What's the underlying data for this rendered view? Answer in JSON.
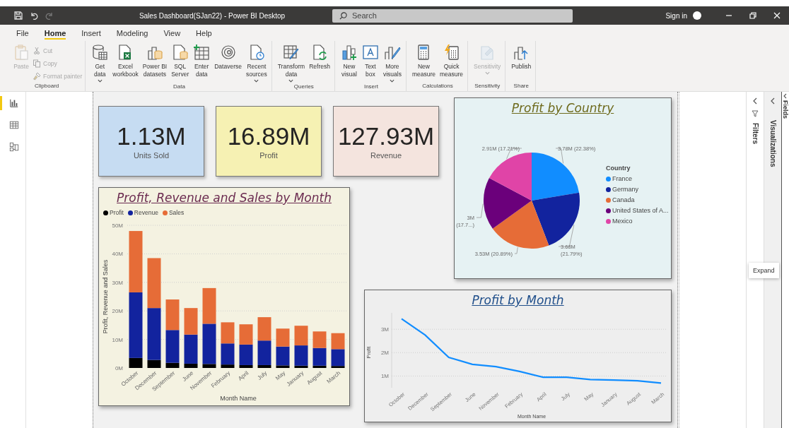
{
  "window": {
    "title": "Sales Dashboard(SJan22) - Power BI Desktop",
    "search": {
      "placeholder": "Search"
    },
    "sign_in": "Sign in"
  },
  "menu_tabs": [
    {
      "label": "File",
      "selected": false
    },
    {
      "label": "Home",
      "selected": true
    },
    {
      "label": "Insert",
      "selected": false
    },
    {
      "label": "Modeling",
      "selected": false
    },
    {
      "label": "View",
      "selected": false
    },
    {
      "label": "Help",
      "selected": false
    }
  ],
  "ribbon": {
    "groups": [
      {
        "label": "Clipboard",
        "buttons": [
          {
            "label": "Paste",
            "kind": "large",
            "disabled": true,
            "dropdown": false
          },
          {
            "label": "Cut",
            "kind": "small",
            "disabled": true,
            "dropdown": false
          },
          {
            "label": "Copy",
            "kind": "small",
            "disabled": true,
            "dropdown": false
          },
          {
            "label": "Format painter",
            "kind": "small",
            "disabled": true,
            "dropdown": false
          }
        ]
      },
      {
        "label": "Data",
        "buttons": [
          {
            "label": "Get\ndata",
            "kind": "large",
            "disabled": false,
            "dropdown": true
          },
          {
            "label": "Excel\nworkbook",
            "kind": "large",
            "disabled": false,
            "dropdown": false
          },
          {
            "label": "Power BI\ndatasets",
            "kind": "large",
            "disabled": false,
            "dropdown": false
          },
          {
            "label": "SQL\nServer",
            "kind": "large",
            "disabled": false,
            "dropdown": false
          },
          {
            "label": "Enter\ndata",
            "kind": "large",
            "disabled": false,
            "dropdown": false
          },
          {
            "label": "Dataverse",
            "kind": "large",
            "disabled": false,
            "dropdown": false
          },
          {
            "label": "Recent\nsources",
            "kind": "large",
            "disabled": false,
            "dropdown": true
          }
        ]
      },
      {
        "label": "Queries",
        "buttons": [
          {
            "label": "Transform\ndata",
            "kind": "large",
            "disabled": false,
            "dropdown": true
          },
          {
            "label": "Refresh",
            "kind": "large",
            "disabled": false,
            "dropdown": false
          }
        ]
      },
      {
        "label": "Insert",
        "buttons": [
          {
            "label": "New\nvisual",
            "kind": "large",
            "disabled": false,
            "dropdown": false
          },
          {
            "label": "Text\nbox",
            "kind": "large",
            "disabled": false,
            "dropdown": false
          },
          {
            "label": "More\nvisuals",
            "kind": "large",
            "disabled": false,
            "dropdown": true
          }
        ]
      },
      {
        "label": "Calculations",
        "buttons": [
          {
            "label": "New\nmeasure",
            "kind": "large",
            "disabled": false,
            "dropdown": false
          },
          {
            "label": "Quick\nmeasure",
            "kind": "large",
            "disabled": false,
            "dropdown": false
          }
        ]
      },
      {
        "label": "Sensitivity",
        "buttons": [
          {
            "label": "Sensitivity",
            "kind": "large",
            "disabled": true,
            "dropdown": true
          }
        ]
      },
      {
        "label": "Share",
        "buttons": [
          {
            "label": "Publish",
            "kind": "large",
            "disabled": false,
            "dropdown": false
          }
        ]
      }
    ]
  },
  "view_nav": [
    {
      "selected": true
    },
    {
      "selected": false
    },
    {
      "selected": false
    }
  ],
  "cards": [
    {
      "value": "1.13M",
      "label": "Units Sold",
      "color": "#c6dcf2"
    },
    {
      "value": "16.89M",
      "label": "Profit",
      "color": "#f6f1b3"
    },
    {
      "value": "127.93M",
      "label": "Revenue",
      "color": "#f4e4de"
    }
  ],
  "bar_visual": {
    "title": "Profit, Revenue and Sales by Month",
    "chart_data": {
      "type": "bar",
      "stacked": true,
      "orientation": "vertical",
      "xlabel": "Month Name",
      "ylabel": "Profit, Revenue and Sales",
      "categories": [
        "October",
        "December",
        "September",
        "June",
        "November",
        "February",
        "April",
        "July",
        "May",
        "January",
        "August",
        "March"
      ],
      "series": [
        {
          "name": "Profit",
          "color": "#000000",
          "values": [
            3.5,
            2.8,
            1.8,
            1.5,
            1.4,
            1.2,
            1,
            1,
            0.9,
            0.8,
            0.8,
            0.7
          ]
        },
        {
          "name": "Revenue",
          "color": "#12239e",
          "values": [
            23,
            18.2,
            11.5,
            10.2,
            14.1,
            7.4,
            7.2,
            8.6,
            6.6,
            7.1,
            6.2,
            5.9
          ]
        },
        {
          "name": "Sales",
          "color": "#e66c37",
          "values": [
            21.5,
            17.5,
            10.7,
            9.3,
            12.5,
            7.4,
            7.1,
            8.2,
            6.3,
            6.9,
            5.8,
            5.6
          ]
        }
      ],
      "ylim": [
        0,
        50
      ],
      "grid": true,
      "yticks": [
        {
          "value": 0,
          "label": "0M"
        },
        {
          "value": 10,
          "label": "10M"
        },
        {
          "value": 20,
          "label": "20M"
        },
        {
          "value": 30,
          "label": "30M"
        },
        {
          "value": 40,
          "label": "40M"
        },
        {
          "value": 50,
          "label": "50M"
        }
      ]
    }
  },
  "pie_visual": {
    "title": "Profit by Country",
    "legend_title": "Country",
    "chart_data": {
      "type": "pie",
      "categories": [
        "France",
        "Germany",
        "Canada",
        "United States of A...",
        "Mexico"
      ],
      "values": [
        22.38,
        21.79,
        20.89,
        17.73,
        17.21
      ],
      "colors": [
        "#118dff",
        "#12239e",
        "#e66c37",
        "#6b007b",
        "#e044a7"
      ],
      "data_labels": true,
      "value_labels": [
        "3.78M (22.38%)",
        "3.68M (21.79%)",
        "3.53M (20.89%)",
        "3M (17.7...)",
        "2.91M (17.21%)"
      ]
    }
  },
  "line_visual": {
    "title": "Profit by Month",
    "chart_data": {
      "type": "line",
      "xlabel": "Month Name",
      "ylabel": "Profit",
      "categories": [
        "October",
        "December",
        "September",
        "June",
        "November",
        "February",
        "April",
        "July",
        "May",
        "January",
        "August",
        "March"
      ],
      "series": [
        {
          "color": "#118dff",
          "values": [
            3.45,
            2.75,
            1.8,
            1.5,
            1.4,
            1.2,
            0.95,
            0.95,
            0.85,
            0.83,
            0.8,
            0.7
          ]
        }
      ],
      "ylim": [
        0.5,
        3.7
      ],
      "grid": true,
      "yticks": [
        {
          "value": 1,
          "label": "1M"
        },
        {
          "value": 2,
          "label": "2M"
        },
        {
          "value": 3,
          "label": "3M"
        }
      ]
    }
  },
  "panes": {
    "filters": {
      "label": "Filters"
    },
    "visualizations": {
      "label": "Visualizations"
    },
    "fields": {
      "label": "Fields"
    }
  },
  "tooltip": "Expand"
}
